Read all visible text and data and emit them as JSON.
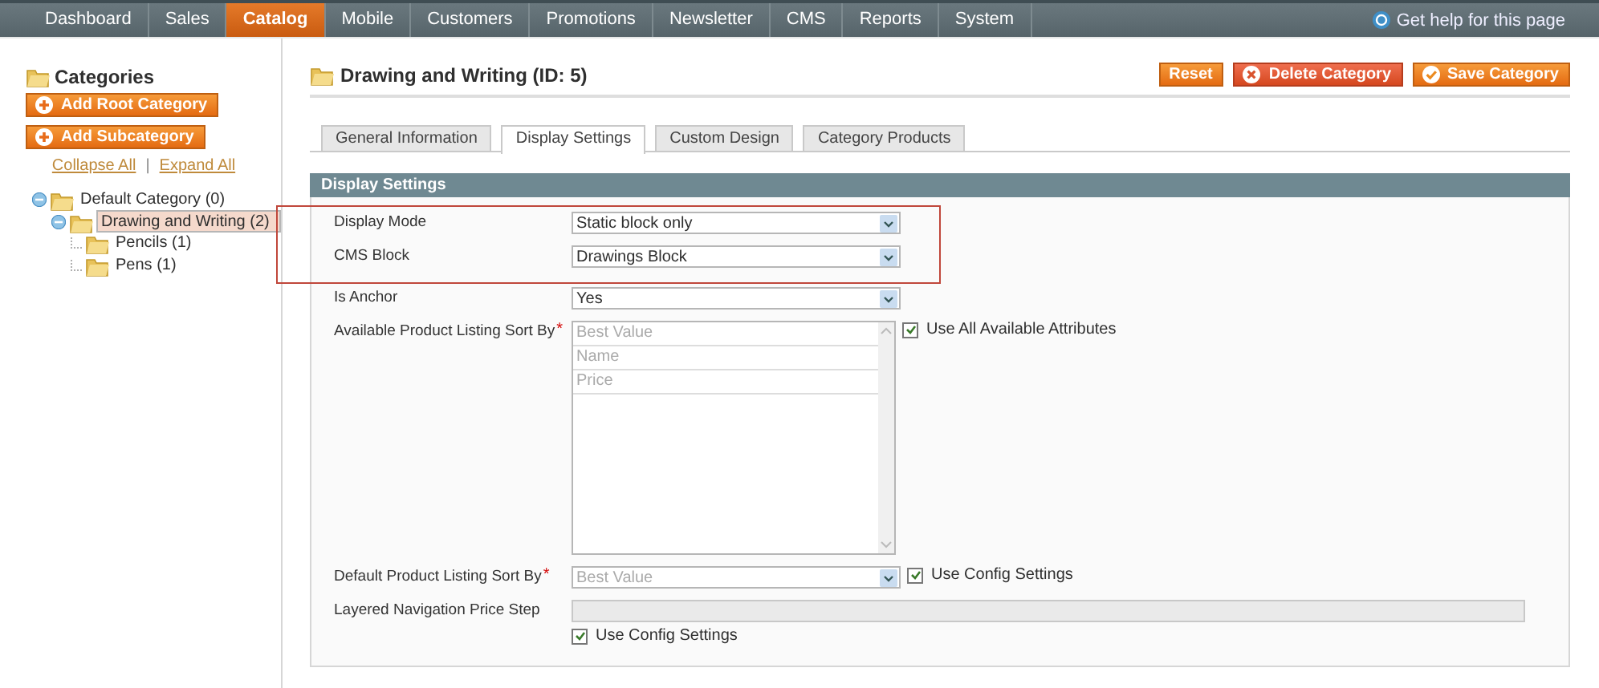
{
  "nav": {
    "items": [
      {
        "label": "Dashboard",
        "selected": false
      },
      {
        "label": "Sales",
        "selected": false
      },
      {
        "label": "Catalog",
        "selected": true
      },
      {
        "label": "Mobile",
        "selected": false
      },
      {
        "label": "Customers",
        "selected": false
      },
      {
        "label": "Promotions",
        "selected": false
      },
      {
        "label": "Newsletter",
        "selected": false
      },
      {
        "label": "CMS",
        "selected": false
      },
      {
        "label": "Reports",
        "selected": false
      },
      {
        "label": "System",
        "selected": false
      }
    ],
    "help": "Get help for this page"
  },
  "sidebar": {
    "title": "Categories",
    "buttons": [
      "Add Root Category",
      "Add Subcategory"
    ],
    "links": [
      "Collapse All",
      "Expand All"
    ],
    "separator": "|",
    "tree": [
      {
        "label": "Default Category (0)",
        "expanded": true,
        "selected": false,
        "children": [
          {
            "label": "Drawing and Writing (2)",
            "expanded": true,
            "selected": true,
            "children": [
              {
                "label": "Pencils (1)",
                "selected": false
              },
              {
                "label": "Pens (1)",
                "selected": false
              }
            ]
          }
        ]
      }
    ]
  },
  "main": {
    "title": "Drawing and Writing (ID: 5)",
    "buttons": [
      {
        "label": "Reset",
        "kind": "plain"
      },
      {
        "label": "Delete Category",
        "kind": "delete"
      },
      {
        "label": "Save Category",
        "kind": "save"
      }
    ],
    "tabs": [
      {
        "label": "General Information",
        "selected": false
      },
      {
        "label": "Display Settings",
        "selected": true
      },
      {
        "label": "Custom Design",
        "selected": false
      },
      {
        "label": "Category Products",
        "selected": false
      }
    ],
    "section": "Display Settings",
    "fields": [
      {
        "kind": "select",
        "label": "Display Mode",
        "value": "Static block only",
        "highlighted": true,
        "disabled": false
      },
      {
        "kind": "select",
        "label": "CMS Block",
        "value": "Drawings Block",
        "highlighted": true,
        "disabled": false
      },
      {
        "kind": "select",
        "label": "Is Anchor",
        "value": "Yes",
        "highlighted": false,
        "disabled": false
      },
      {
        "kind": "multiselect",
        "label": "Available Product Listing Sort By",
        "required_mark": "*",
        "options": [
          "Best Value",
          "Name",
          "Price"
        ],
        "highlighted": false,
        "disabled": true,
        "checkbox": {
          "label": "Use All Available Attributes",
          "checked": true
        }
      },
      {
        "kind": "select",
        "label": "Default Product Listing Sort By",
        "required_mark": "*",
        "value": "Best Value",
        "highlighted": false,
        "disabled": true,
        "checkbox": {
          "label": "Use Config Settings",
          "checked": true
        }
      },
      {
        "kind": "text",
        "label": "Layered Navigation Price Step",
        "highlighted": false,
        "disabled": true,
        "checkbox": {
          "label": "Use Config Settings",
          "checked": true
        }
      }
    ]
  }
}
